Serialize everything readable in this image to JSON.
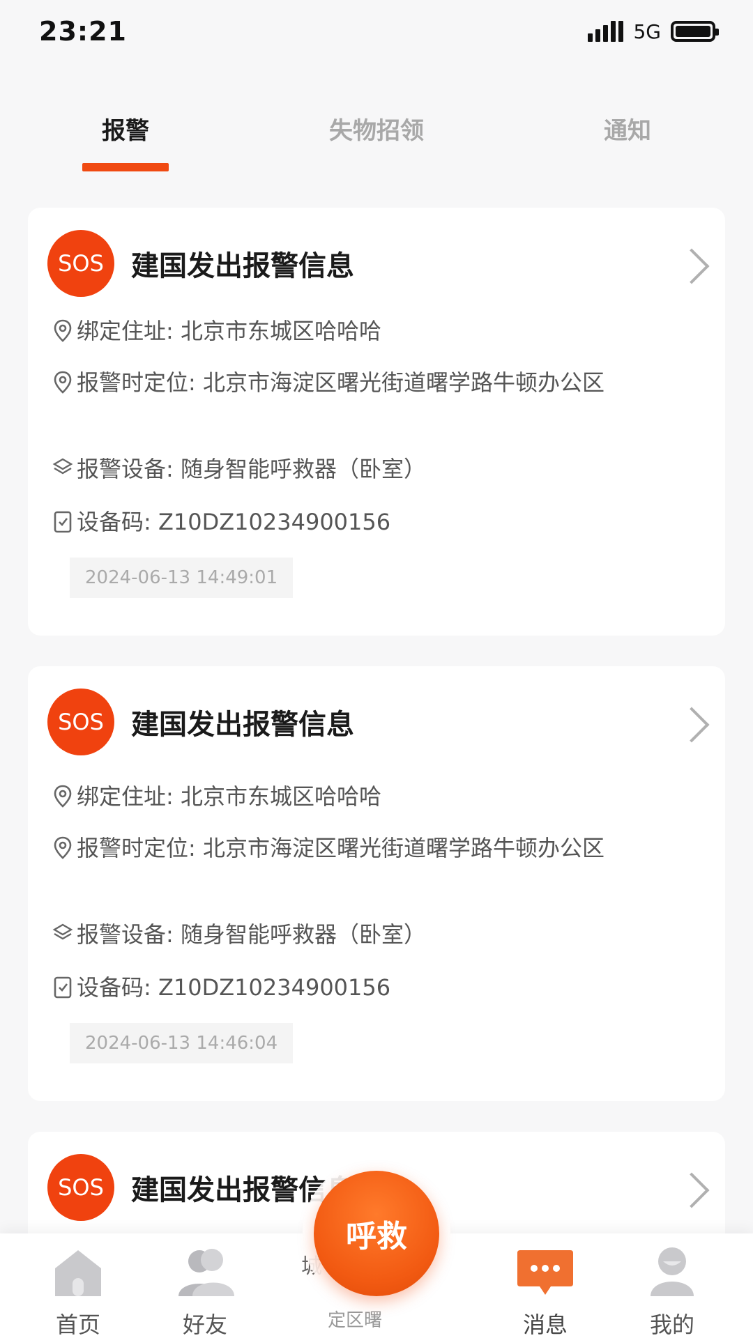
{
  "status_bar": {
    "time": "23:21",
    "network": "5G"
  },
  "tabs": [
    {
      "label": "报警",
      "active": true
    },
    {
      "label": "失物招领",
      "active": false
    },
    {
      "label": "通知",
      "active": false
    }
  ],
  "colors": {
    "accent": "#f04a12",
    "sos": "#f0420f"
  },
  "alerts": [
    {
      "badge": "SOS",
      "title": "建国发出报警信息",
      "bound_address": "绑定住址: 北京市东城区哈哈哈",
      "alarm_location": "报警时定位: 北京市海淀区曙光街道曙学路牛顿办公区",
      "device": "报警设备: 随身智能呼救器（卧室）",
      "device_code": "设备码: Z10DZ10234900156",
      "time": "2024-06-13 14:49:01"
    },
    {
      "badge": "SOS",
      "title": "建国发出报警信息",
      "bound_address": "绑定住址: 北京市东城区哈哈哈",
      "alarm_location": "报警时定位: 北京市海淀区曙光街道曙学路牛顿办公区",
      "device": "报警设备: 随身智能呼救器（卧室）",
      "device_code": "设备码: Z10DZ10234900156",
      "time": "2024-06-13 14:46:04"
    },
    {
      "badge": "SOS",
      "title": "建国发出报警信息"
    }
  ],
  "peek": {
    "line1": "城",
    "line2": "定区曙"
  },
  "call_button": "呼救",
  "bottom_nav": [
    {
      "label": "首页",
      "icon": "home-icon"
    },
    {
      "label": "好友",
      "icon": "friends-icon"
    },
    {
      "label": "消息",
      "icon": "message-icon",
      "active": true
    },
    {
      "label": "我的",
      "icon": "profile-icon"
    }
  ]
}
